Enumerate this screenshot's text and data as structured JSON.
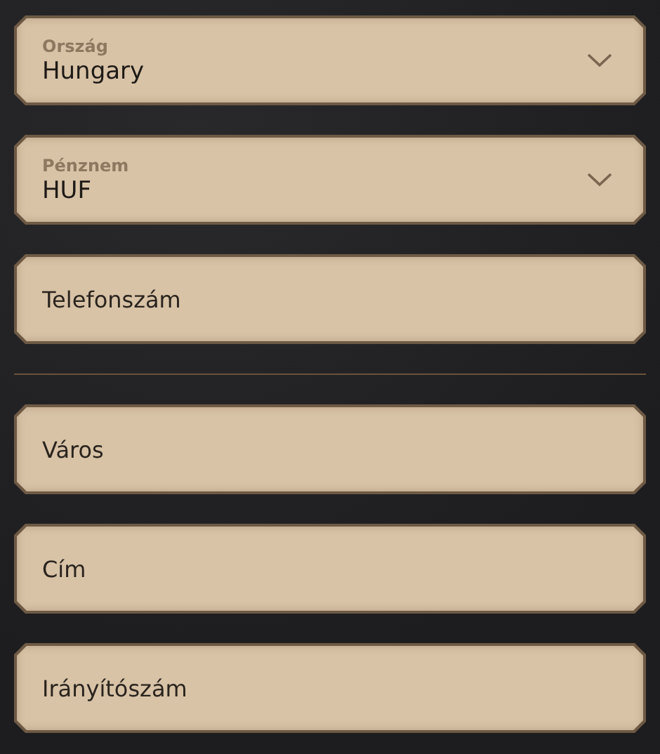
{
  "sections": [
    {
      "fields": [
        {
          "kind": "select",
          "label": "Ország",
          "value": "Hungary"
        },
        {
          "kind": "select",
          "label": "Pénznem",
          "value": "HUF"
        },
        {
          "kind": "text",
          "placeholder": "Telefonszám"
        }
      ]
    },
    {
      "fields": [
        {
          "kind": "text",
          "placeholder": "Város"
        },
        {
          "kind": "text",
          "placeholder": "Cím"
        },
        {
          "kind": "text",
          "placeholder": "Irányítószám"
        }
      ]
    }
  ]
}
